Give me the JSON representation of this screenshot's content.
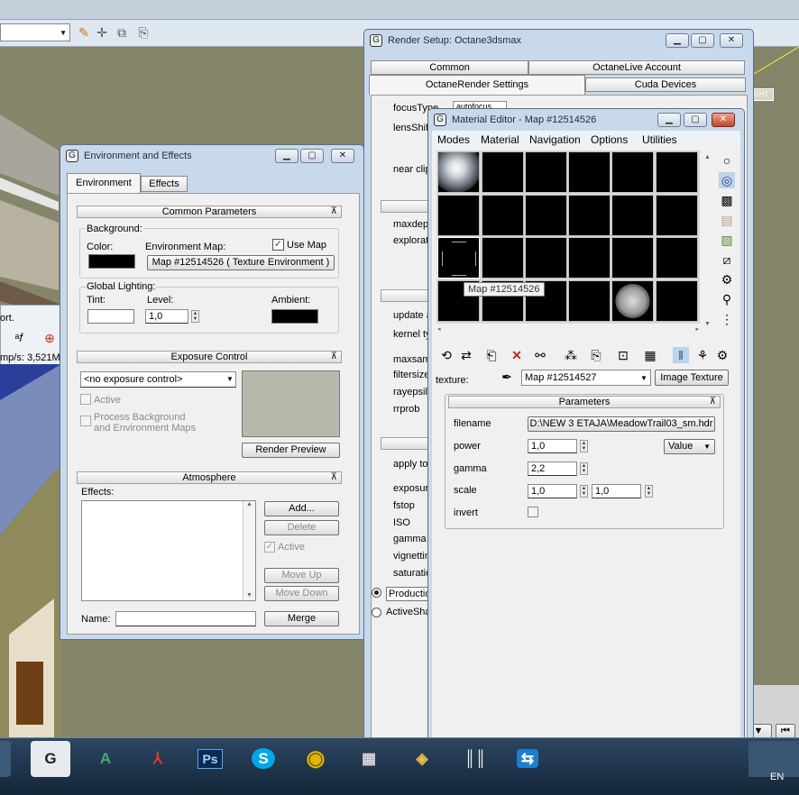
{
  "colors": {
    "viewport": "#85856a",
    "window_frame": "#c9d9ec",
    "panel": "#f0f0f0",
    "taskbar": "#172a3f",
    "accent": "#3366cc"
  },
  "main_toolbar": {
    "icons": [
      "selection-set-icon",
      "move-icon",
      "select-filter-icon",
      "named-set-icon"
    ]
  },
  "viewport_left": {
    "label": "ort.",
    "speed": "mp/s: 3,521M."
  },
  "viewport_label_right": "IGHT",
  "render_setup": {
    "title": "Render Setup: Octane3dsmax",
    "tabs": {
      "common": "Common",
      "octanelive": "OctaneLive Account",
      "settings": "OctaneRender Settings",
      "cuda": "Cuda Devices"
    },
    "labels": {
      "focustype": "focusType",
      "focustype_value": "autofocus",
      "lensshift": "lensShift",
      "nearclip": "near clip",
      "maxdepth": "maxdep",
      "exploration": "explorat",
      "update": "update a",
      "kernel": "kernel ty",
      "maxsamples": "maxsam",
      "filtersize": "filtersize",
      "rayepsilon": "rayepsil",
      "rrprob": "rrprob",
      "applyto": "apply to",
      "exposure": "exposur",
      "fstop": "fstop",
      "iso": "ISO",
      "gamma": "gamma",
      "vignetting": "vignettin",
      "saturation": "saturatio"
    },
    "production_label": "Productio",
    "activeshade_label": "ActiveSha"
  },
  "env_effects": {
    "title": "Environment and Effects",
    "tabs": {
      "environment": "Environment",
      "effects": "Effects"
    },
    "common_params": {
      "header": "Common Parameters",
      "background": "Background:",
      "color": "Color:",
      "env_map": "Environment Map:",
      "use_map": "Use Map",
      "map_button": "Map #12514526  ( Texture Environment )",
      "global_lighting": "Global Lighting:",
      "tint": "Tint:",
      "level": "Level:",
      "level_value": "1,0",
      "ambient": "Ambient:"
    },
    "exposure": {
      "header": "Exposure Control",
      "dropdown": "<no exposure control>",
      "active": "Active",
      "process_bg_1": "Process Background",
      "process_bg_2": "and Environment Maps",
      "render_preview": "Render Preview"
    },
    "atmosphere": {
      "header": "Atmosphere",
      "effects_label": "Effects:",
      "add": "Add...",
      "delete": "Delete",
      "active": "Active",
      "move_up": "Move Up",
      "move_down": "Move Down",
      "name_label": "Name:",
      "merge": "Merge"
    }
  },
  "material_editor": {
    "title": "Material Editor - Map #12514526",
    "menu": {
      "modes": "Modes",
      "material": "Material",
      "navigation": "Navigation",
      "options": "Options",
      "utilities": "Utilities"
    },
    "tooltip": "Map #12514526",
    "texture_label": "texture:",
    "map_dropdown": "Map #12514527",
    "image_texture": "Image Texture",
    "parameters": {
      "header": "Parameters",
      "filename_label": "filename",
      "filename_value": "D:\\NEW 3 ETAJA\\MeadowTrail03_sm.hdr",
      "power_label": "power",
      "power_value": "1,0",
      "value_dropdown": "Value",
      "gamma_label": "gamma",
      "gamma_value": "2,2",
      "scale_label": "scale",
      "scale_x": "1,0",
      "scale_y": "1,0",
      "invert_label": "invert"
    }
  },
  "taskbar": {
    "apps": [
      {
        "name": "3dsmax",
        "glyph": "G"
      },
      {
        "name": "autocad",
        "glyph": "A"
      },
      {
        "name": "acrobat",
        "glyph": "⅄"
      },
      {
        "name": "photoshop",
        "glyph": "Ps"
      },
      {
        "name": "skype",
        "glyph": "S"
      },
      {
        "name": "chrome",
        "glyph": "◉"
      },
      {
        "name": "calculator",
        "glyph": "▦"
      },
      {
        "name": "folders",
        "glyph": "◈"
      },
      {
        "name": "library",
        "glyph": "║║"
      },
      {
        "name": "teamviewer",
        "glyph": "⇆"
      }
    ],
    "language": "EN"
  }
}
